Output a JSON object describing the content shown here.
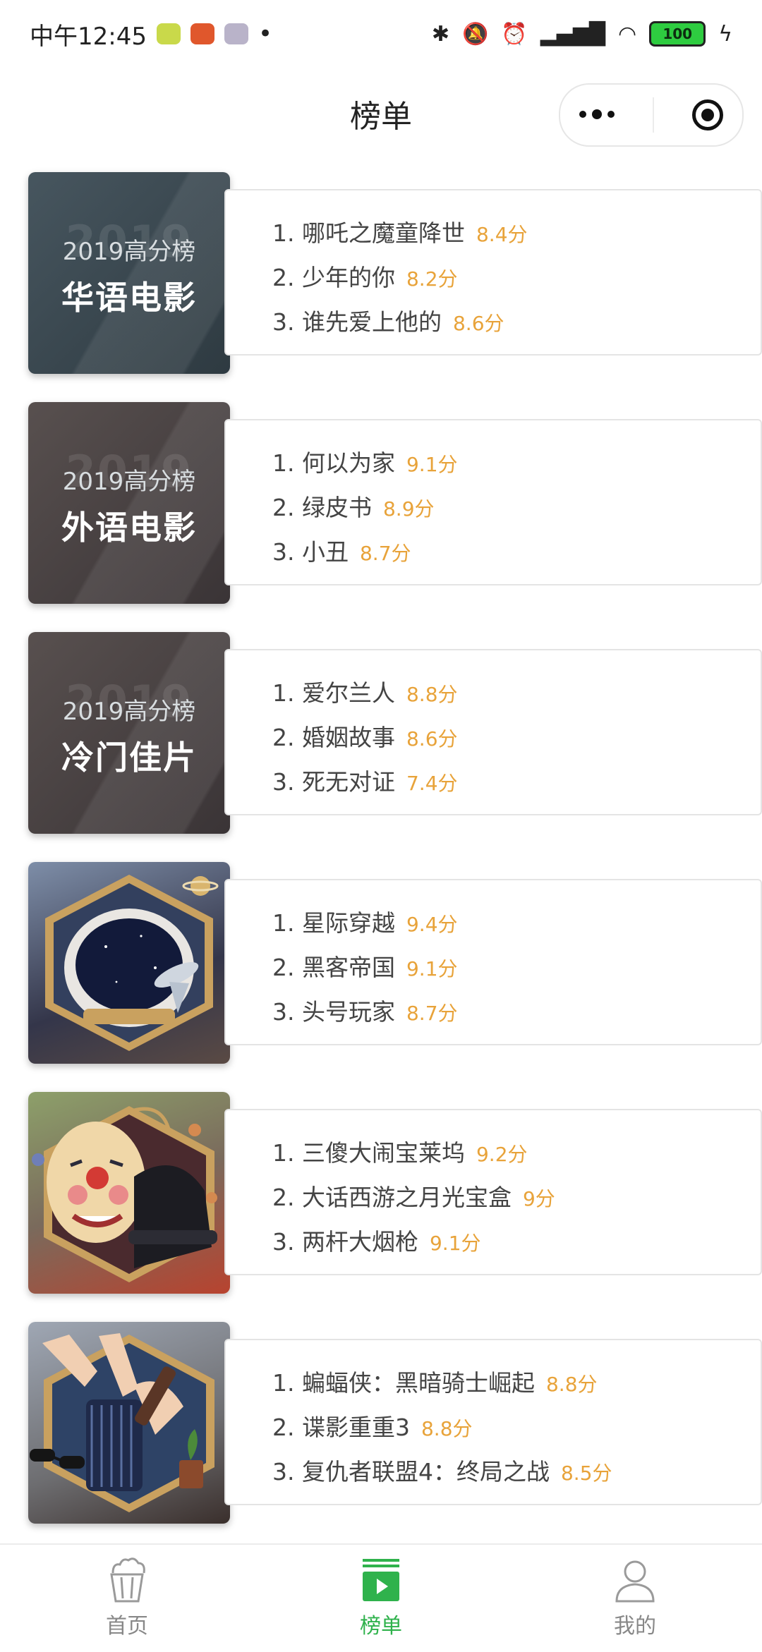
{
  "status_bar": {
    "time": "中午12:45",
    "battery": "100",
    "dot": "•"
  },
  "header": {
    "title": "榜单"
  },
  "lists": [
    {
      "thumb_year_ghost": "2019",
      "thumb_sub": "2019高分榜",
      "thumb_main": "华语电影",
      "movies": [
        {
          "title": "1. 哪吒之魔童降世",
          "score": "8.4分"
        },
        {
          "title": "2. 少年的你",
          "score": "8.2分"
        },
        {
          "title": "3. 谁先爱上他的",
          "score": "8.6分"
        }
      ]
    },
    {
      "thumb_year_ghost": "2019",
      "thumb_sub": "2019高分榜",
      "thumb_main": "外语电影",
      "movies": [
        {
          "title": "1. 何以为家",
          "score": "9.1分"
        },
        {
          "title": "2. 绿皮书",
          "score": "8.9分"
        },
        {
          "title": "3. 小丑",
          "score": "8.7分"
        }
      ]
    },
    {
      "thumb_year_ghost": "2019",
      "thumb_sub": "2019高分榜",
      "thumb_main": "冷门佳片",
      "movies": [
        {
          "title": "1. 爱尔兰人",
          "score": "8.8分"
        },
        {
          "title": "2. 婚姻故事",
          "score": "8.6分"
        },
        {
          "title": "3. 死无对证",
          "score": "7.4分"
        }
      ]
    },
    {
      "movies": [
        {
          "title": "1. 星际穿越",
          "score": "9.4分"
        },
        {
          "title": "2. 黑客帝国",
          "score": "9.1分"
        },
        {
          "title": "3. 头号玩家",
          "score": "8.7分"
        }
      ]
    },
    {
      "movies": [
        {
          "title": "1. 三傻大闹宝莱坞",
          "score": "9.2分"
        },
        {
          "title": "2. 大话西游之月光宝盒",
          "score": "9分"
        },
        {
          "title": "3. 两杆大烟枪",
          "score": "9.1分"
        }
      ]
    },
    {
      "movies": [
        {
          "title": "1. 蝙蝠侠：黑暗骑士崛起",
          "score": "8.8分"
        },
        {
          "title": "2. 谍影重重3",
          "score": "8.8分"
        },
        {
          "title": "3. 复仇者联盟4：终局之战",
          "score": "8.5分"
        }
      ]
    }
  ],
  "tabs": [
    {
      "label": "首页",
      "icon": "popcorn-icon"
    },
    {
      "label": "榜单",
      "icon": "play-board-icon"
    },
    {
      "label": "我的",
      "icon": "person-icon"
    }
  ],
  "colors": {
    "score": "#e8a33a",
    "active_tab": "#2fb24c",
    "thumb1_bg": "#3c4a52",
    "thumb2_bg": "#4a4446",
    "thumb3_bg": "#4a4446"
  }
}
